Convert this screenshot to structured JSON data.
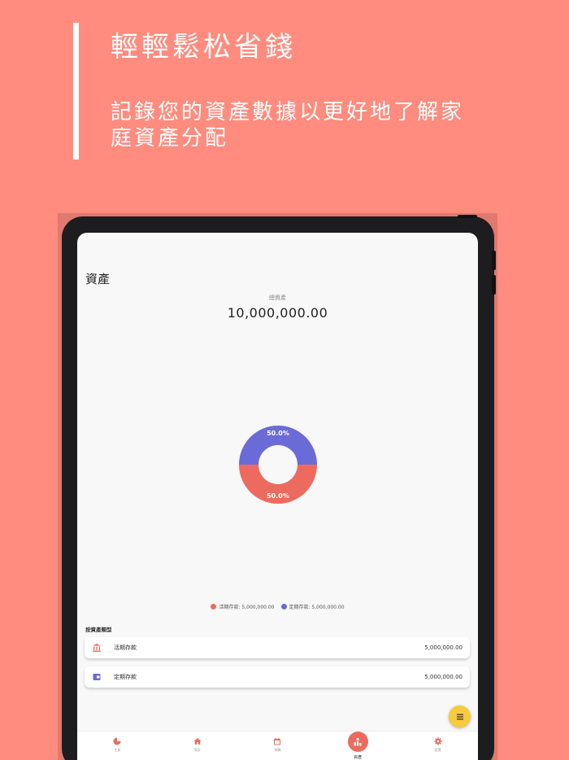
{
  "promo": {
    "title": "輕輕鬆松省錢",
    "subtitle": "記錄您的資產數據以更好地了解家庭資產分配"
  },
  "screen": {
    "page_title": "資產",
    "total_label": "總資產",
    "total_value": "10,000,000.00",
    "section_label": "按資產類型",
    "assets": [
      {
        "name": "活期存款",
        "amount": "5,000,000.00",
        "icon": "bank-icon",
        "icon_color": "#EC6B5E"
      },
      {
        "name": "定期存款",
        "amount": "5,000,000.00",
        "icon": "wallet-icon",
        "icon_color": "#6A6BD6"
      }
    ],
    "legend": [
      {
        "text": "活期存款: 5,000,000.00",
        "color": "#EC6B5E"
      },
      {
        "text": "定期存款: 5,000,000.00",
        "color": "#6A6BD6"
      }
    ],
    "nav": [
      {
        "label": "主頁",
        "icon": "pie-chart-icon"
      },
      {
        "label": "家計",
        "icon": "home-icon"
      },
      {
        "label": "預算",
        "icon": "calendar-icon"
      },
      {
        "label": "資產",
        "icon": "assets-icon",
        "active": true
      },
      {
        "label": "設置",
        "icon": "gear-icon"
      }
    ]
  },
  "chart_data": {
    "type": "pie",
    "categories": [
      "活期存款",
      "定期存款"
    ],
    "values": [
      5000000,
      5000000
    ],
    "labels": [
      "50.0%",
      "50.0%"
    ],
    "colors": [
      "#EC6B5E",
      "#6A6BD6"
    ]
  }
}
